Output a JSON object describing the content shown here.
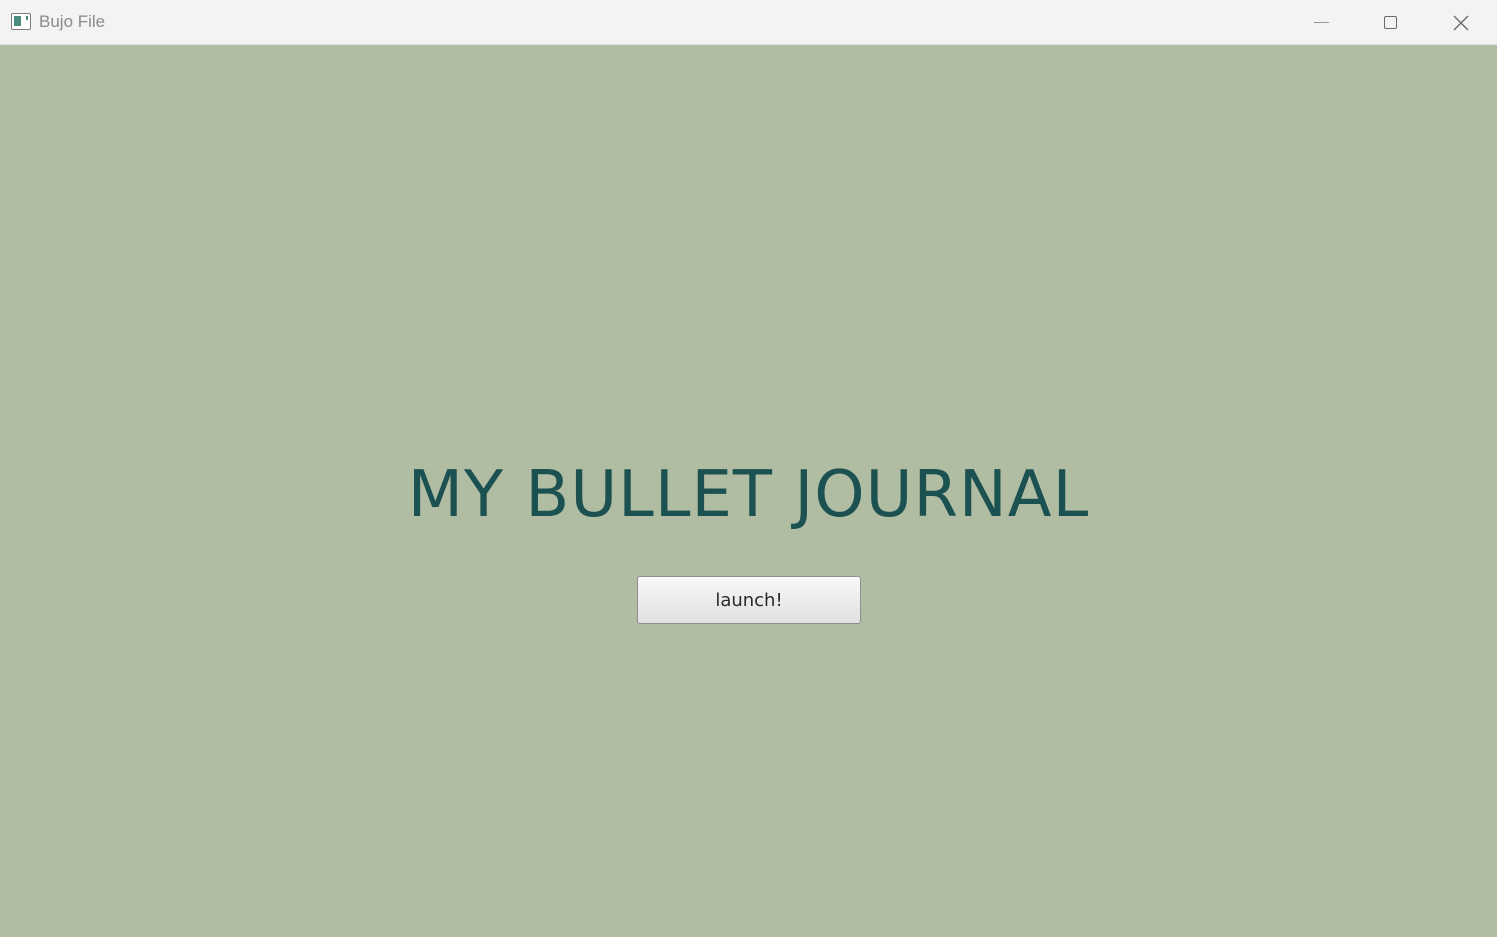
{
  "window": {
    "title": "Bujo File",
    "controls": {
      "minimize_icon": "minimize-icon",
      "maximize_icon": "maximize-icon",
      "close_icon": "close-icon"
    }
  },
  "main": {
    "heading": "MY BULLET JOURNAL",
    "launch_label": "launch!"
  },
  "colors": {
    "background": "#b1bda2",
    "heading": "#1c5152",
    "titlebar": "#f3f3f3"
  }
}
